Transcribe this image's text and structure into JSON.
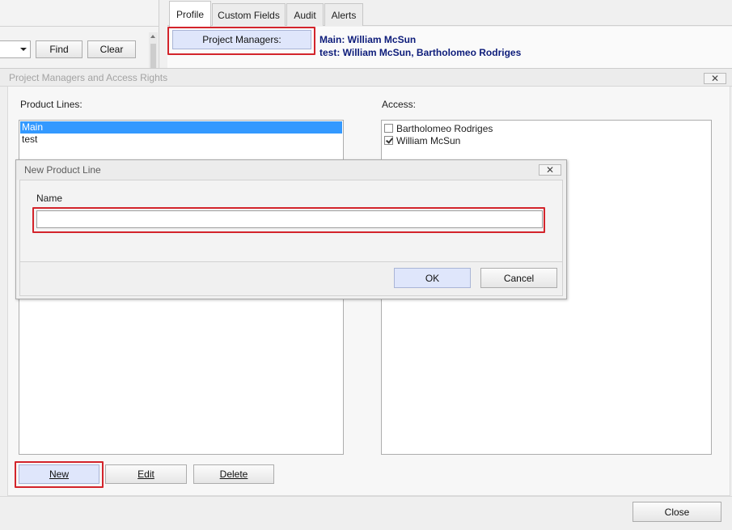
{
  "background": {
    "search": {
      "find_label": "Find",
      "clear_label": "Clear"
    },
    "tabs": [
      {
        "label": "Profile",
        "active": true
      },
      {
        "label": "Custom Fields",
        "active": false
      },
      {
        "label": "Audit",
        "active": false
      },
      {
        "label": "Alerts",
        "active": false
      }
    ],
    "profile": {
      "project_managers_button": "Project Managers:",
      "lines": [
        "Main: William McSun",
        "test: William McSun, Bartholomeo Rodriges"
      ]
    }
  },
  "dialog": {
    "title": "Project Managers and Access Rights",
    "product_lines_label": "Product Lines:",
    "product_lines": [
      {
        "name": "Main",
        "selected": true
      },
      {
        "name": "test",
        "selected": false
      }
    ],
    "access_label": "Access:",
    "access": [
      {
        "name": "Bartholomeo Rodriges",
        "checked": false
      },
      {
        "name": "William McSun",
        "checked": true
      }
    ],
    "new_button": "New",
    "edit_button": "Edit",
    "delete_button": "Delete",
    "close_button": "Close"
  },
  "modal": {
    "title": "New Product Line",
    "name_label": "Name",
    "name_value": "",
    "ok_button": "OK",
    "cancel_button": "Cancel"
  },
  "colors": {
    "highlight": "#d3242b",
    "selection": "#3399ff",
    "link_text": "#0d1c7a",
    "primary_button": "#dfe6fb"
  },
  "icons": {
    "close": "close-icon",
    "dropdown": "chevron-down-icon",
    "scroll_up": "scroll-up-icon",
    "check": "checkmark-icon"
  }
}
